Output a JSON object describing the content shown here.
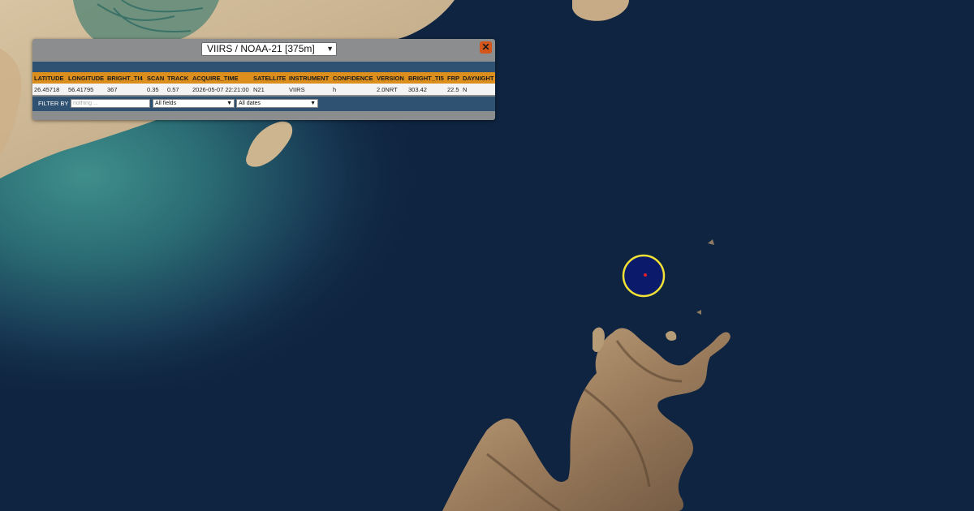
{
  "panel": {
    "layer_select": "VIIRS / NOAA-21 [375m]",
    "close_symbol": "✕",
    "columns": [
      "LATITUDE",
      "LONGITUDE",
      "BRIGHT_TI4",
      "SCAN",
      "TRACK",
      "ACQUIRE_TIME",
      "SATELLITE",
      "INSTRUMENT",
      "CONFIDENCE",
      "VERSION",
      "BRIGHT_TI5",
      "FRP",
      "DAYNIGHT"
    ],
    "rows": [
      [
        "26.45718",
        "56.41795",
        "367",
        "0.35",
        "0.57",
        "2026-05-07 22:21:00",
        "N21",
        "VIIRS",
        "h",
        "2.0NRT",
        "303.42",
        "22.5",
        "N"
      ]
    ],
    "filter": {
      "label": "FILTER BY",
      "placeholder": "nothing ...",
      "field_select": "All fields",
      "date_select": "All dates"
    }
  },
  "colors": {
    "header_accent": "#dc8f1c",
    "band": "#2f5273",
    "close": "#d5561b",
    "sea": "#0f2440",
    "marker_ring": "#f2e234",
    "marker_fill": "#0c1a6b",
    "marker_dot": "#e0202a"
  },
  "icons": {
    "close": "close-icon",
    "dropdown": "chevron-down-icon",
    "fire_marker": "fire-detection-marker"
  }
}
